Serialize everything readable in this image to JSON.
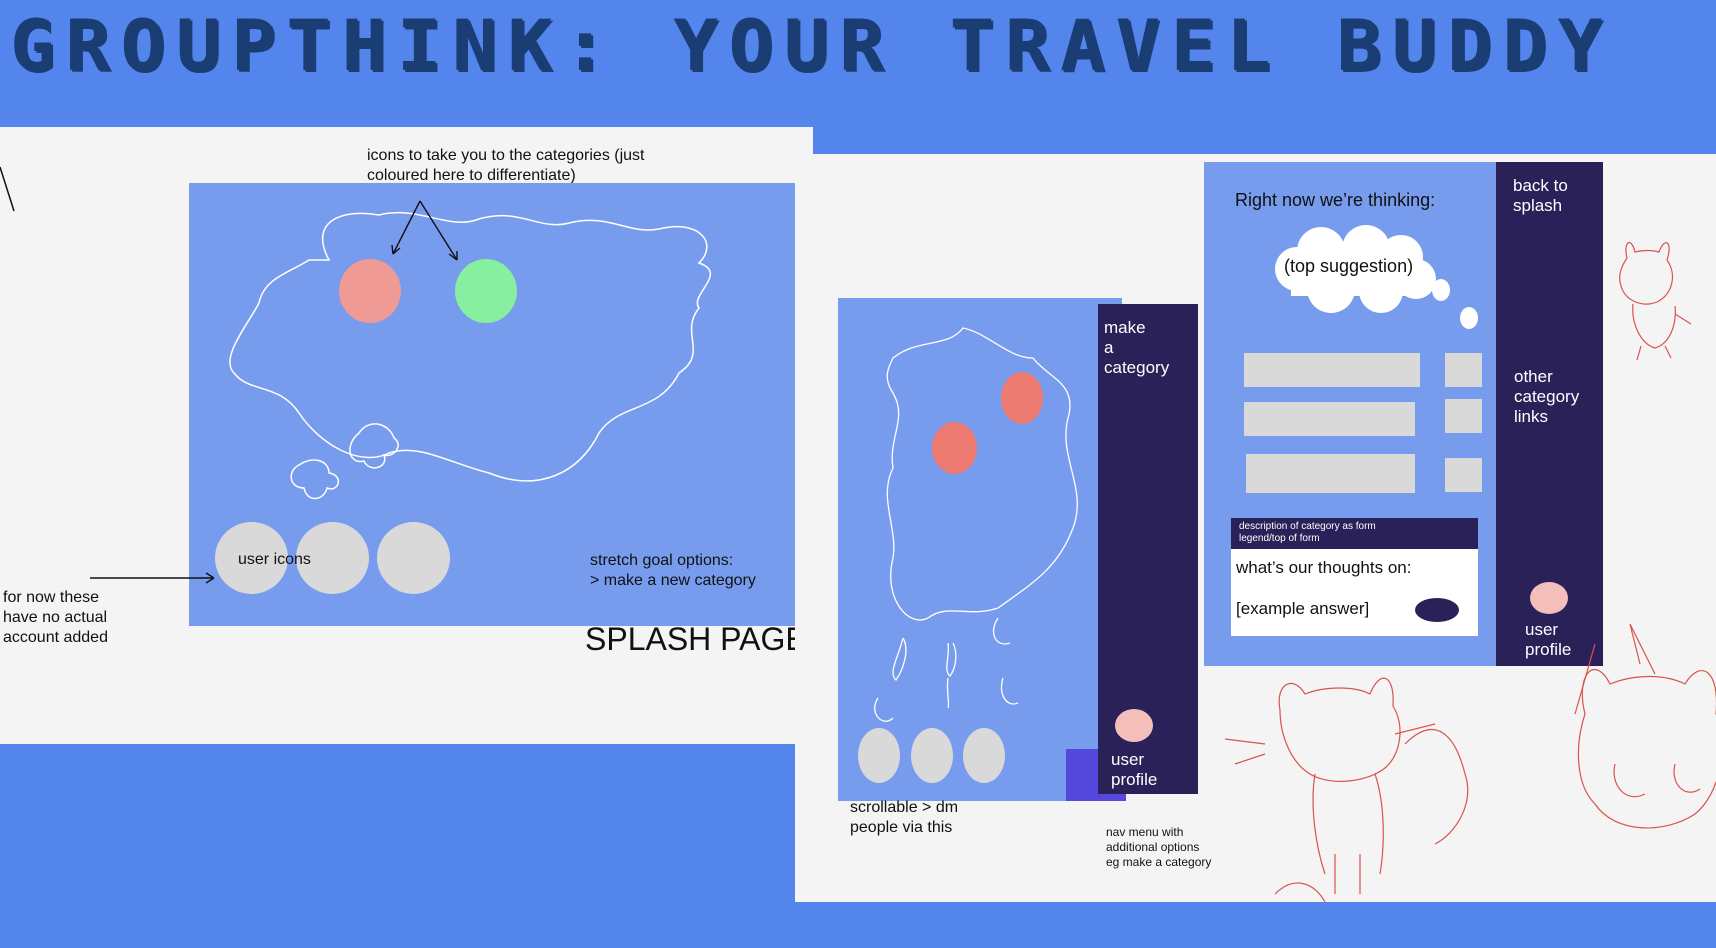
{
  "title": "GROUPTHINK:  YOUR  TRAVEL  BUDDY",
  "splash": {
    "annotation_icons": "icons to take you to the categories (just coloured here to differentiate)",
    "user_icons_label": "user icons",
    "stretch_goal": "stretch goal options:\n> make a new category",
    "page_label": "SPLASH PAGE",
    "note_accounts": "for now these\nhave no actual\naccount added",
    "colors": {
      "category_red": "#EF9A94",
      "category_green": "#86EFA0"
    }
  },
  "category_screen": {
    "make_category": "make\na\ncategory",
    "user_profile": "user\nprofile",
    "scrollable_note": "scrollable > dm\npeople via this",
    "nav_note": "nav menu with\nadditional options\neg make a category"
  },
  "thinking_screen": {
    "heading": "Right now we’re thinking:",
    "top_suggestion": "(top suggestion)",
    "back_to_splash": "back to\nsplash",
    "other_links": "other\ncategory\nlinks",
    "form_legend": "description of category as form\nlegend/top of form",
    "form_question": "what’s our thoughts on:",
    "form_answer": "[example answer]",
    "user_profile": "user\nprofile"
  }
}
